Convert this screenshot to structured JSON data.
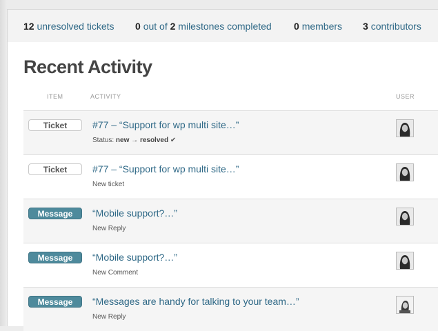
{
  "stats": [
    {
      "count": "12",
      "label": "unresolved tickets"
    },
    {
      "count": "0",
      "mid": "out of",
      "total": "2",
      "label": "milestones completed"
    },
    {
      "count": "0",
      "label": "members"
    },
    {
      "count": "3",
      "label": "contributors"
    }
  ],
  "page_title": "Recent Activity",
  "columns": {
    "item": "ITEM",
    "activity": "ACTIVITY",
    "user": "USER"
  },
  "rows": [
    {
      "type": "Ticket",
      "title": "#77 – “Support for wp multi site…”",
      "status_label": "Status:",
      "status_from": "new",
      "arrow": "→",
      "status_to": "resolved",
      "check": "✔"
    },
    {
      "type": "Ticket",
      "title": "#77 – “Support for wp multi site…”",
      "sub": "New ticket"
    },
    {
      "type": "Message",
      "title": "“Mobile support?…”",
      "sub": "New Reply"
    },
    {
      "type": "Message",
      "title": "“Mobile support?…”",
      "sub": "New Comment"
    },
    {
      "type": "Message",
      "title": "“Messages are handy for talking to your team…”",
      "sub": "New Reply"
    }
  ],
  "colors": {
    "link": "#2e6886",
    "message_badge": "#4e8a9c"
  }
}
